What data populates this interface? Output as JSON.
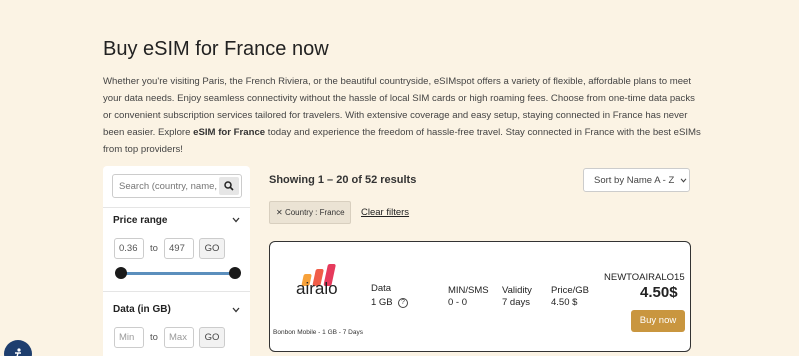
{
  "page": {
    "title": "Buy eSIM for France now",
    "intro_1": "Whether you're visiting Paris, the French Riviera, or the beautiful countryside, eSIMspot offers a variety of flexible, affordable plans to meet your data needs. Enjoy seamless connectivity without the hassle of local SIM cards or high roaming fees. Choose from one-time data packs or convenient subscription services tailored for travelers. With extensive coverage and easy setup, staying connected in France has never been easier. Explore ",
    "intro_bold": "eSIM for France",
    "intro_2": " today and experience the freedom of hassle-free travel. Stay connected in France with the best eSIMs from top providers!"
  },
  "sidebar": {
    "search_placeholder": "Search (country, name, network...)",
    "search_icon": "search-icon",
    "price_range": {
      "title": "Price range",
      "min": "0.36",
      "separator": "to",
      "max": "497",
      "go_label": "GO",
      "slider_min_fraction": 0,
      "slider_max_fraction": 1
    },
    "data_filter": {
      "title": "Data (in GB)",
      "min_placeholder": "Min",
      "separator": "to",
      "max_placeholder": "Max",
      "go_label": "GO"
    }
  },
  "results": {
    "count_text": "Showing 1 – 20 of 52 results",
    "sort_label": "Sort by Name A - Z",
    "active_filter": "Country : France",
    "remove_glyph": "✕",
    "clear_label": "Clear filters"
  },
  "plans": [
    {
      "brand": "airalo",
      "subtitle": "Bonbon Mobile - 1 GB - 7 Days",
      "data_label": "Data",
      "data_value": "1 GB",
      "minsms_label": "MIN/SMS",
      "minsms_value": "0 - 0",
      "validity_label": "Validity",
      "validity_value": "7 days",
      "pricegb_label": "Price/GB",
      "pricegb_value": "4.50 $",
      "promo_code": "NEWTOAIRALO15",
      "price": "4.50$",
      "buy_label": "Buy now"
    }
  ],
  "colors": {
    "background": "#fbf3e4",
    "accent": "#c9963f",
    "slider": "#5b8fbd",
    "badge": "#1e3e6e"
  }
}
